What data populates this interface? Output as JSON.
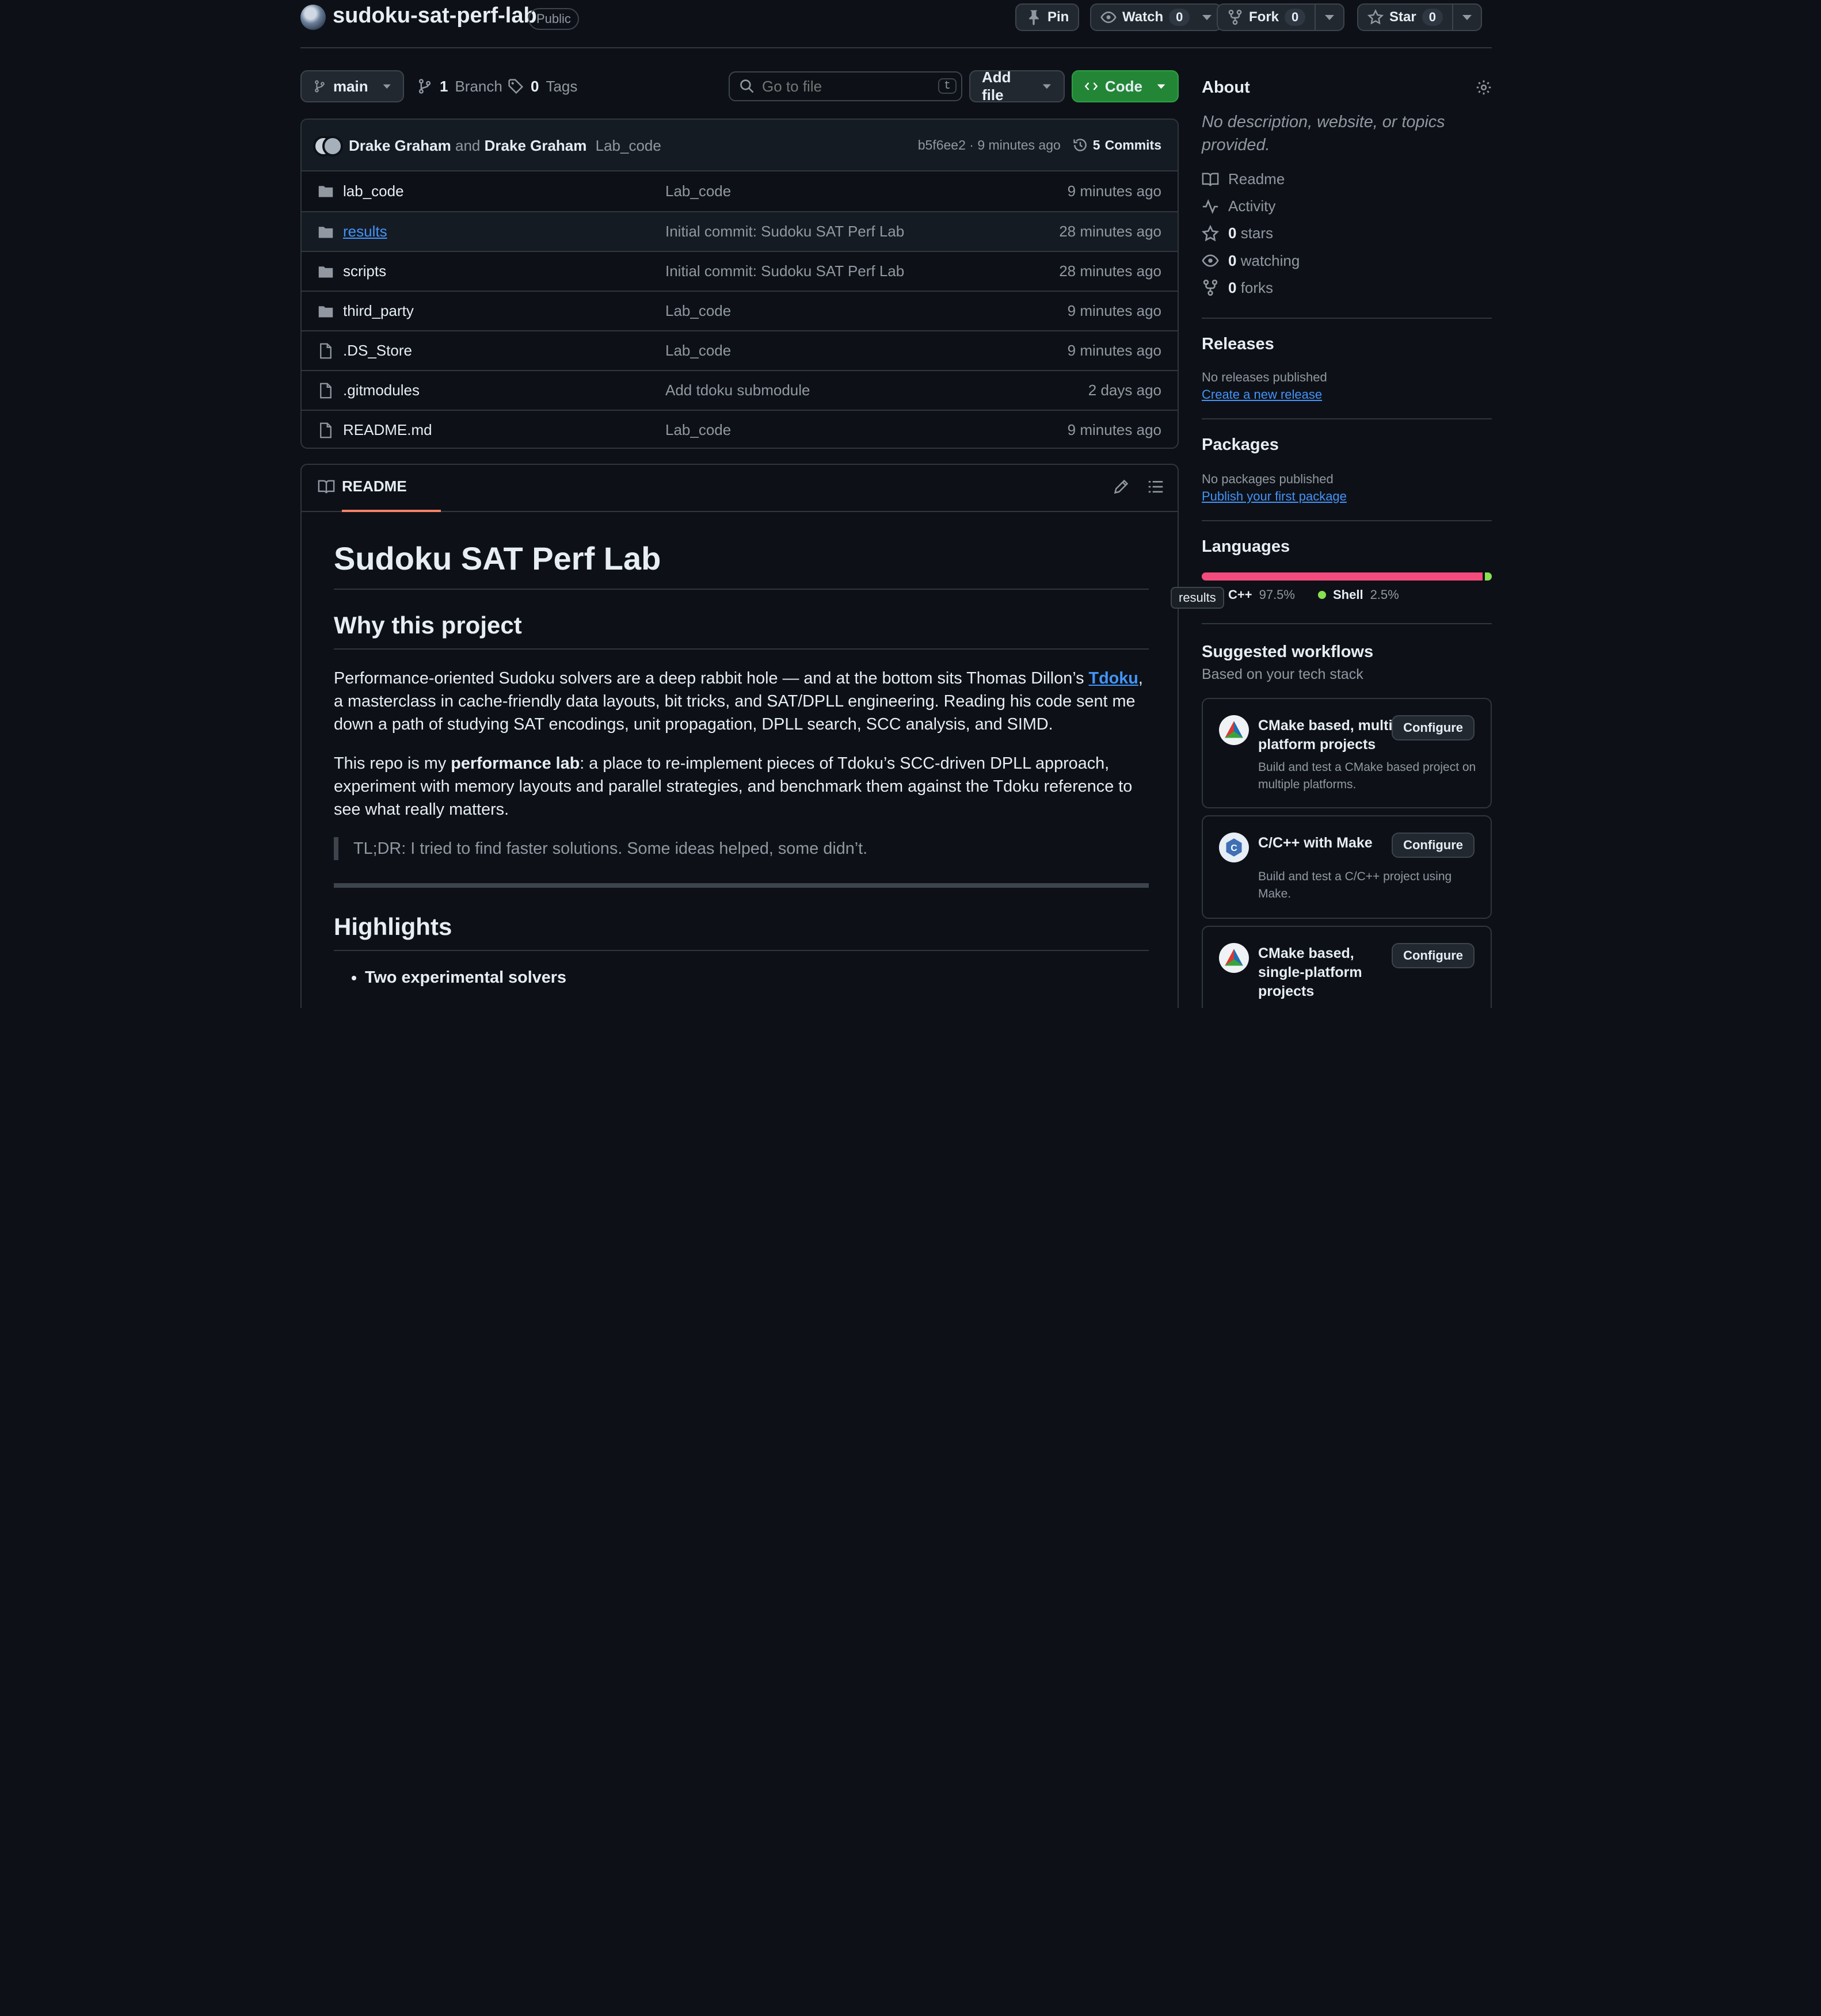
{
  "repo": {
    "name": "sudoku-sat-perf-lab",
    "visibility": "Public",
    "pin_label": "Pin",
    "watch_label": "Watch",
    "watch_count": "0",
    "fork_label": "Fork",
    "fork_count": "0",
    "star_label": "Star",
    "star_count": "0"
  },
  "toolbar": {
    "branch": "main",
    "branch_count": "1",
    "branch_label": "Branch",
    "tags_count": "0",
    "tags_label": "Tags",
    "search_placeholder": "Go to file",
    "search_shortcut": "t",
    "add_file_label": "Add file",
    "code_label": "Code"
  },
  "commit": {
    "author1": "Drake Graham",
    "and": "and",
    "author2": "Drake Graham",
    "message": "Lab_code",
    "sha": "b5f6ee2",
    "separator": "·",
    "time": "9 minutes ago",
    "commits_count": "5",
    "commits_label": "Commits"
  },
  "files": [
    {
      "type": "folder",
      "name": "lab_code",
      "message": "Lab_code",
      "time": "9 minutes ago"
    },
    {
      "type": "folder",
      "name": "results",
      "message": "Initial commit: Sudoku SAT Perf Lab",
      "time": "28 minutes ago"
    },
    {
      "type": "folder",
      "name": "scripts",
      "message": "Initial commit: Sudoku SAT Perf Lab",
      "time": "28 minutes ago"
    },
    {
      "type": "folder",
      "name": "third_party",
      "message": "Lab_code",
      "time": "9 minutes ago"
    },
    {
      "type": "file",
      "name": ".DS_Store",
      "message": "Lab_code",
      "time": "9 minutes ago"
    },
    {
      "type": "file",
      "name": ".gitmodules",
      "message": "Add tdoku submodule",
      "time": "2 days ago"
    },
    {
      "type": "file",
      "name": "README.md",
      "message": "Lab_code",
      "time": "9 minutes ago"
    }
  ],
  "readme": {
    "tab_label": "README",
    "h1": "Sudoku SAT Perf Lab",
    "h2_why": "Why this project",
    "p1_before": "Performance-oriented Sudoku solvers are a deep rabbit hole — and at the bottom sits Thomas Dillon’s ",
    "p1_link": "Tdoku",
    "p1_after": ", a masterclass in cache-friendly data layouts, bit tricks, and SAT/DPLL engineering. Reading his code sent me down a path of studying SAT encodings, unit propagation, DPLL search, SCC analysis, and SIMD.",
    "p2_before": "This repo is my ",
    "p2_bold": "performance lab",
    "p2_after": ": a place to re-implement pieces of Tdoku’s SCC-driven DPLL approach, experiment with memory layouts and parallel strategies, and benchmark them against the Tdoku reference to see what really matters.",
    "quote": "TL;DR: I tried to find faster solutions. Some ideas helped, some didn’t.",
    "h2_highlights": "Highlights",
    "bullet1": "Two experimental solvers"
  },
  "about": {
    "title": "About",
    "description": "No description, website, or topics provided.",
    "readme": "Readme",
    "activity": "Activity",
    "stars_count": "0",
    "stars_label": "stars",
    "watching_count": "0",
    "watching_label": "watching",
    "forks_count": "0",
    "forks_label": "forks"
  },
  "releases": {
    "title": "Releases",
    "none": "No releases published",
    "create": "Create a new release"
  },
  "packages": {
    "title": "Packages",
    "none": "No packages published",
    "publish": "Publish your first package"
  },
  "languages": {
    "title": "Languages",
    "items": [
      {
        "name": "C++",
        "percent": "97.5%",
        "value": 97.5,
        "color": "#f34b7d"
      },
      {
        "name": "Shell",
        "percent": "2.5%",
        "value": 2.5,
        "color": "#89e051"
      }
    ],
    "tooltip": "results"
  },
  "workflows": {
    "title": "Suggested workflows",
    "subtitle": "Based on your tech stack",
    "configure_label": "Configure",
    "items": [
      {
        "title": "CMake based, multi-platform projects",
        "desc": "Build and test a CMake based project on multiple platforms."
      },
      {
        "title": "C/C++ with Make",
        "desc": "Build and test a C/C++ project using Make."
      },
      {
        "title": "CMake based, single-platform projects",
        "desc": ""
      }
    ]
  },
  "colors": {
    "background": "#0d1117",
    "border": "#30363d",
    "accent_link": "#4493f8",
    "code_button": "#238636",
    "tab_underline": "#f78166"
  }
}
